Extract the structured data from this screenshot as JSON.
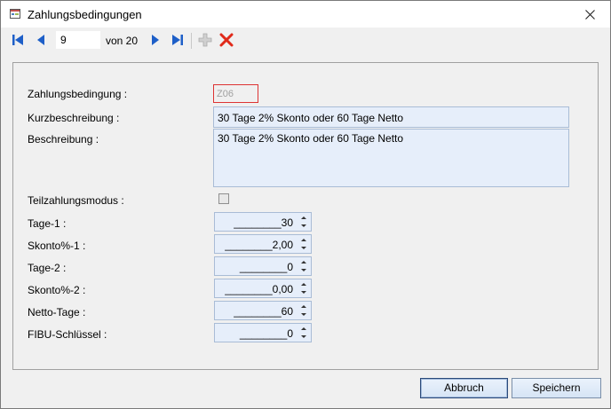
{
  "window": {
    "title": "Zahlungsbedingungen"
  },
  "icons": {
    "app": "form-icon",
    "close": "close-icon",
    "first": "first-record-icon",
    "prev": "previous-record-icon",
    "next": "next-record-icon",
    "last": "last-record-icon",
    "add": "add-icon",
    "delete": "delete-icon"
  },
  "navigator": {
    "position": "9",
    "of_label": "von 20"
  },
  "form": {
    "code_label": "Zahlungsbedingung :",
    "code_value": "Z06",
    "short_label": "Kurzbeschreibung :",
    "short_value": "30 Tage 2% Skonto oder 60 Tage Netto",
    "desc_label": "Beschreibung :",
    "desc_value": "30 Tage 2% Skonto oder 60 Tage Netto",
    "partial_label": "Teilzahlungsmodus :",
    "partial_checked": false,
    "tage1_label": "Tage-1 :",
    "tage1_value": "________30",
    "skonto1_label": "Skonto%-1 :",
    "skonto1_value": "________2,00",
    "tage2_label": "Tage-2 :",
    "tage2_value": "________0",
    "skonto2_label": "Skonto%-2 :",
    "skonto2_value": "________0,00",
    "netto_label": "Netto-Tage :",
    "netto_value": "________60",
    "fibu_label": "FIBU-Schlüssel :",
    "fibu_value": "________0"
  },
  "buttons": {
    "cancel": "Abbruch",
    "save": "Speichern"
  },
  "colors": {
    "field_bg": "#e6eefa",
    "field_border": "#a9bcd6",
    "nav_blue": "#1e5fc8",
    "delete_red": "#e02a1a",
    "required_border": "#dd3333"
  }
}
